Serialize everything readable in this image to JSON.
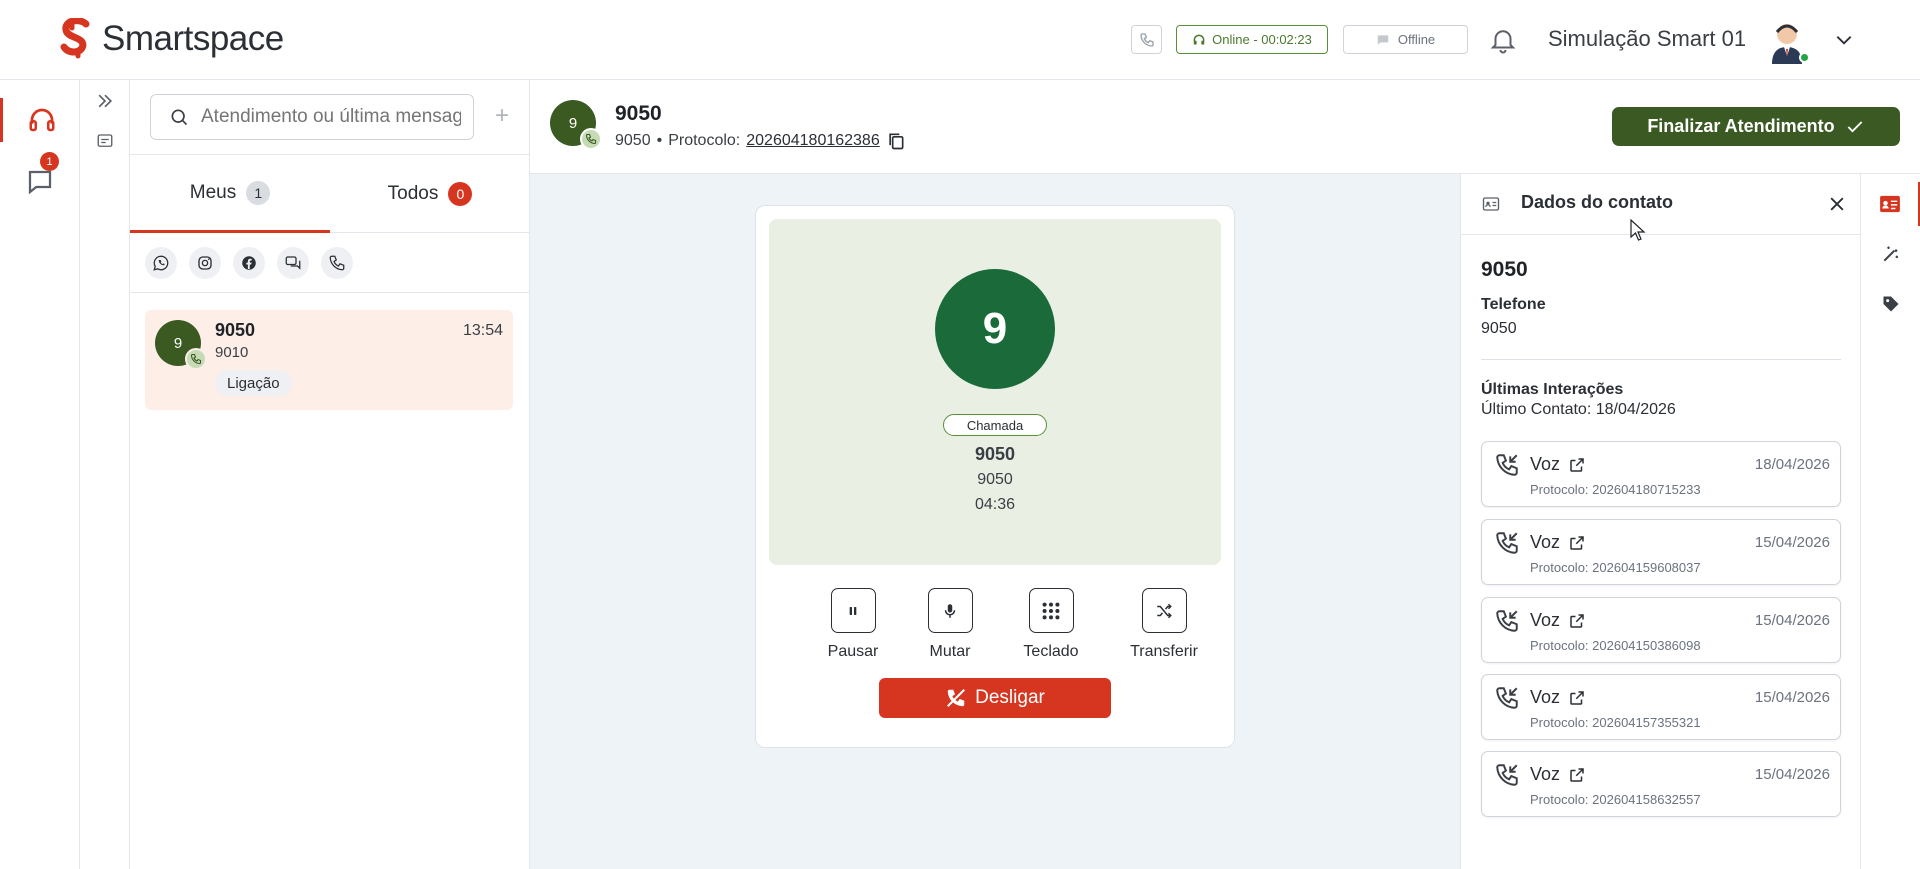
{
  "brand": {
    "name": "Smartspace",
    "accent": "#d6361f",
    "green": "#3b5a23"
  },
  "topbar": {
    "status_online": "Online - 00:02:23",
    "status_offline": "Offline",
    "user_name": "Simulação Smart 01"
  },
  "rail": {
    "chat_badge": "1"
  },
  "conversations": {
    "search_placeholder": "Atendimento ou última mensagem",
    "add_label": "+",
    "tabs": [
      {
        "label": "Meus",
        "count": "1"
      },
      {
        "label": "Todos",
        "count": "0"
      }
    ],
    "channels": [
      "whatsapp-icon",
      "instagram-icon",
      "facebook-icon",
      "chat-icon",
      "phone-icon"
    ],
    "items": [
      {
        "avatar": "9",
        "name": "9050",
        "time": "13:54",
        "sub": "9010",
        "tag": "Ligação"
      }
    ]
  },
  "chat_header": {
    "avatar": "9",
    "name": "9050",
    "number": "9050",
    "separator": "•",
    "protocol_label": "Protocolo:",
    "protocol": "202604180162386",
    "finish_label": "Finalizar Atendimento"
  },
  "call": {
    "avatar": "9",
    "tag": "Chamada",
    "name": "9050",
    "number": "9050",
    "timer": "04:36",
    "controls": [
      "Pausar",
      "Mutar",
      "Teclado",
      "Transferir"
    ],
    "hangup_label": "Desligar"
  },
  "contact": {
    "title": "Dados do contato",
    "name": "9050",
    "phone_label": "Telefone",
    "phone": "9050",
    "section_title": "Últimas Interações",
    "last_contact": "Último Contato: 18/04/2026",
    "interactions": [
      {
        "title": "Voz",
        "date": "18/04/2026",
        "protocol": "Protocolo: 202604180715233"
      },
      {
        "title": "Voz",
        "date": "15/04/2026",
        "protocol": "Protocolo: 202604159608037"
      },
      {
        "title": "Voz",
        "date": "15/04/2026",
        "protocol": "Protocolo: 202604150386098"
      },
      {
        "title": "Voz",
        "date": "15/04/2026",
        "protocol": "Protocolo: 202604157355321"
      },
      {
        "title": "Voz",
        "date": "15/04/2026",
        "protocol": "Protocolo: 202604158632557"
      }
    ]
  }
}
